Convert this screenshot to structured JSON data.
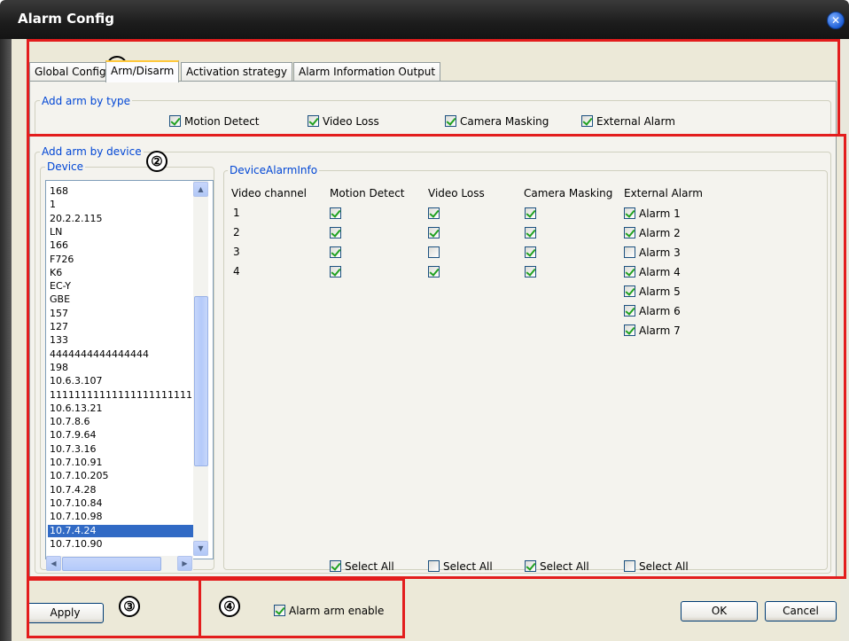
{
  "window": {
    "title": "Alarm Config"
  },
  "tabs": [
    "Global Config",
    "Arm/Disarm",
    "Activation strategy",
    "Alarm Information Output"
  ],
  "arm_by_type": {
    "legend": "Add arm by type",
    "options": [
      {
        "label": "Motion Detect",
        "checked": true
      },
      {
        "label": "Video Loss",
        "checked": true
      },
      {
        "label": "Camera Masking",
        "checked": true
      },
      {
        "label": "External Alarm",
        "checked": true
      }
    ]
  },
  "arm_by_device": {
    "legend": "Add arm by device",
    "device_legend": "Device",
    "devices": [
      "168",
      "1",
      "20.2.2.115",
      "LN",
      "166",
      "F726",
      "K6",
      "EC-Y",
      "GBE",
      "157",
      "127",
      "133",
      "4444444444444444",
      "198",
      "10.6.3.107",
      "1111111111111111111111111",
      "10.6.13.21",
      "10.7.8.6",
      "10.7.9.64",
      "10.7.3.16",
      "10.7.10.91",
      "10.7.10.205",
      "10.7.4.28",
      "10.7.10.84",
      "10.7.10.98",
      "10.7.4.24",
      "10.7.10.90"
    ],
    "selected_device": "10.7.4.24"
  },
  "alarm_info": {
    "legend": "DeviceAlarmInfo",
    "headers": {
      "channel": "Video channel",
      "motion": "Motion Detect",
      "loss": "Video Loss",
      "masking": "Camera Masking",
      "external": "External Alarm"
    },
    "channels": [
      {
        "channel": "1",
        "motion": true,
        "loss": true,
        "masking": true
      },
      {
        "channel": "2",
        "motion": true,
        "loss": true,
        "masking": true
      },
      {
        "channel": "3",
        "motion": true,
        "loss": false,
        "masking": true
      },
      {
        "channel": "4",
        "motion": true,
        "loss": true,
        "masking": true
      }
    ],
    "external_alarms": [
      {
        "label": "Alarm 1",
        "checked": true
      },
      {
        "label": "Alarm 2",
        "checked": true
      },
      {
        "label": "Alarm 3",
        "checked": false
      },
      {
        "label": "Alarm 4",
        "checked": true
      },
      {
        "label": "Alarm 5",
        "checked": true
      },
      {
        "label": "Alarm 6",
        "checked": true
      },
      {
        "label": "Alarm 7",
        "checked": true
      }
    ],
    "select_all": [
      {
        "label": "Select All",
        "checked": true
      },
      {
        "label": "Select All",
        "checked": false
      },
      {
        "label": "Select All",
        "checked": true
      },
      {
        "label": "Select All",
        "checked": false
      }
    ]
  },
  "footer": {
    "apply": "Apply",
    "alarm_arm_enable": {
      "label": "Alarm arm enable",
      "checked": true
    },
    "ok": "OK",
    "cancel": "Cancel"
  },
  "annotations": [
    "①",
    "②",
    "③",
    "④"
  ],
  "colors": {
    "highlight": "#e31d1d",
    "legend_text": "#0046d5",
    "selection": "#316ac5"
  }
}
